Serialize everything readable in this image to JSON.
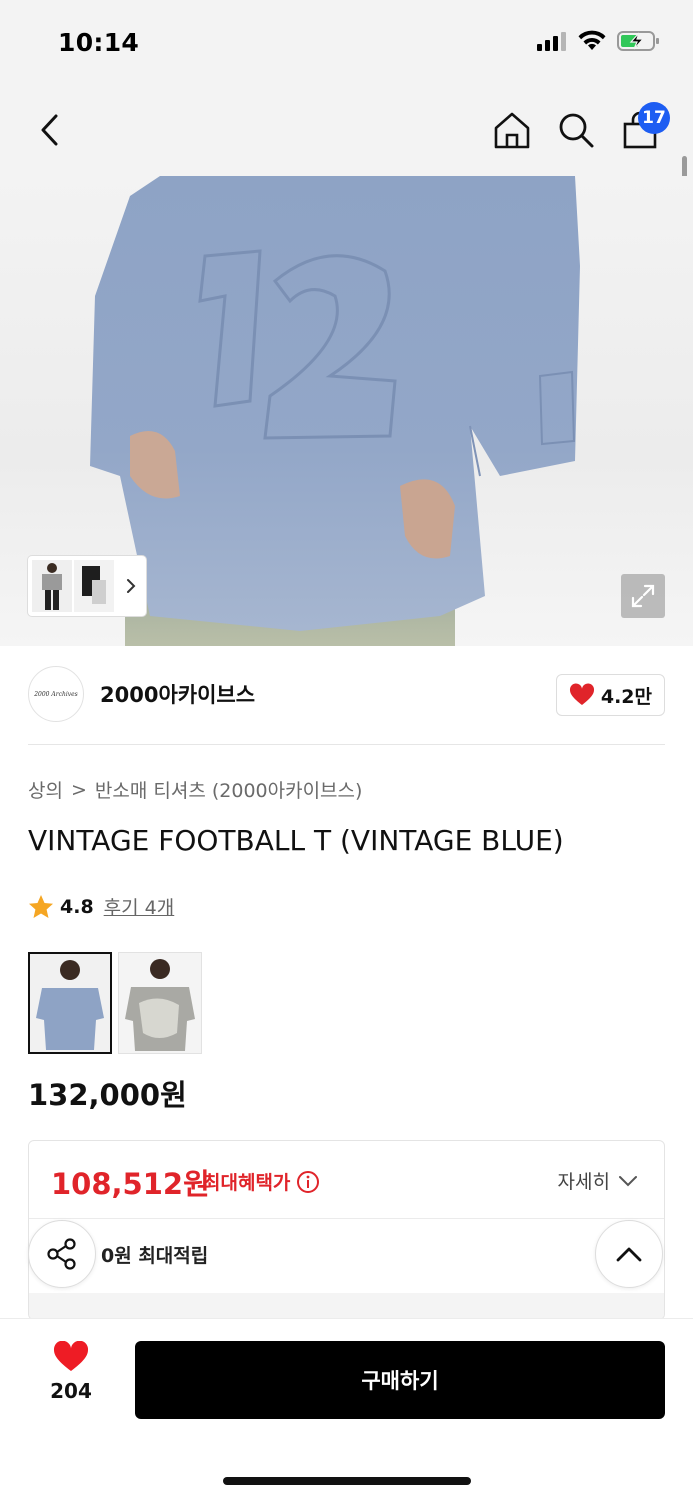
{
  "status": {
    "time": "10:14"
  },
  "nav": {
    "cart_count": "17"
  },
  "brand": {
    "name": "2000아카이브스",
    "logo_text": "2000 Archives",
    "likes": "4.2만"
  },
  "breadcrumb": {
    "category": "상의",
    "separator": ">",
    "subcategory": "반소매 티셔츠 (2000아카이브스)"
  },
  "product": {
    "title": "VINTAGE FOOTBALL T (VINTAGE BLUE)",
    "rating": "4.8",
    "reviews": "후기 4개",
    "price": "132,000원"
  },
  "benefit": {
    "sale_price": "108,512원",
    "sale_label": "최대혜택가",
    "detail_label": "자세히",
    "points_label": "0원 최대적립"
  },
  "bottom": {
    "wish_count": "204",
    "buy_label": "구매하기"
  },
  "colors": {
    "accent_red": "#e0242a",
    "badge_blue": "#1d5df2",
    "shirt_blue": "#8fa4c6"
  }
}
